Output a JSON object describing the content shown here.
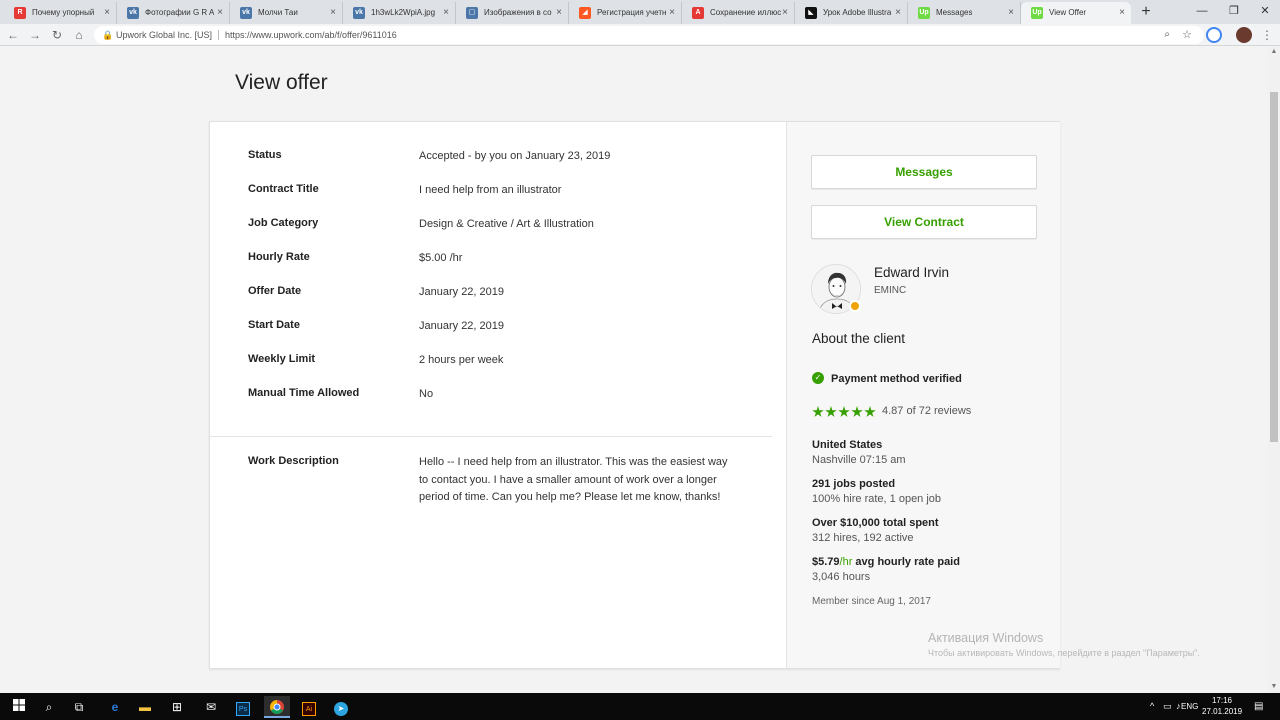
{
  "browser": {
    "tabs": [
      {
        "title": "Почему упорный",
        "favicon_color": "#e53935",
        "favicon_text": "R"
      },
      {
        "title": "Фотографии G R A",
        "favicon_color": "#4a76a8",
        "favicon_text": "vk"
      },
      {
        "title": "Молчи Таи",
        "favicon_color": "#4a76a8",
        "favicon_text": "vk"
      },
      {
        "title": "1h3wLk2WpiA.jpg",
        "favicon_color": "#4a76a8",
        "favicon_text": "vk"
      },
      {
        "title": "Изображения в со",
        "favicon_color": "#4a76a8",
        "favicon_text": "▢"
      },
      {
        "title": "Регистрация учетн",
        "favicon_color": "#ff5722",
        "favicon_text": "◢"
      },
      {
        "title": "Сохранение иллюс",
        "favicon_color": "#e53935",
        "favicon_text": "A"
      },
      {
        "title": "Урок Adobe Illustra",
        "favicon_color": "#111111",
        "favicon_text": "◣"
      },
      {
        "title": "Messages",
        "favicon_color": "#6fda44",
        "favicon_text": "Up"
      },
      {
        "title": "View Offer",
        "favicon_color": "#6fda44",
        "favicon_text": "Up"
      }
    ],
    "tab_close_symbol": "×",
    "new_tab_symbol": "+",
    "window_controls": [
      "—",
      "❐",
      "✕"
    ],
    "nav_buttons": [
      "←",
      "→",
      "↻",
      "⌂"
    ],
    "address": {
      "site": "Upwork Global Inc. [US]",
      "url": "https://www.upwork.com/ab/f/offer/9611016"
    }
  },
  "page": {
    "title": "View offer",
    "details": [
      {
        "label": "Status",
        "value": "Accepted - by you on January 23, 2019"
      },
      {
        "label": "Contract Title",
        "value": "I need help from an illustrator"
      },
      {
        "label": "Job Category",
        "value": "Design & Creative / Art & Illustration"
      },
      {
        "label": "Hourly Rate",
        "value": "$5.00 /hr"
      },
      {
        "label": "Offer Date",
        "value": "January 22, 2019"
      },
      {
        "label": "Start Date",
        "value": "January 22, 2019"
      },
      {
        "label": "Weekly Limit",
        "value": "2 hours per week"
      },
      {
        "label": "Manual Time Allowed",
        "value": "No"
      }
    ],
    "work_description": {
      "label": "Work Description",
      "text": "Hello -- I need help from an illustrator. This was the easiest way to contact you. I have a smaller amount of work over a longer period of time. Can you help me? Please let me know, thanks!"
    },
    "sidebar": {
      "messages_button": "Messages",
      "view_contract_button": "View Contract",
      "client_name": "Edward Irvin",
      "client_company": "EMINC",
      "about_heading": "About the client",
      "payment_verified": "Payment method verified",
      "rating": 4.87,
      "rating_text": "4.87 of 72 reviews",
      "country": "United States",
      "location_time": "Nashville 07:15 am",
      "jobs_posted": "291 jobs posted",
      "hire_rate": "100% hire rate, 1 open job",
      "total_spent": "Over $10,000 total spent",
      "hires": "312 hires, 192 active",
      "avg_rate_value": "$5.79",
      "avg_rate_unit": "/hr",
      "avg_rate_suffix": " avg hourly rate paid",
      "hours": "3,046 hours",
      "member_since": "Member since Aug 1, 2017"
    }
  },
  "watermark": {
    "title": "Активация Windows",
    "subtitle": "Чтобы активировать Windows, перейдите в раздел \"Параметры\"."
  },
  "taskbar": {
    "language": "ENG",
    "time": "17:16",
    "date": "27.01.2019"
  },
  "colors": {
    "accent_green": "#37a000",
    "online_status": "#f0a30a"
  }
}
